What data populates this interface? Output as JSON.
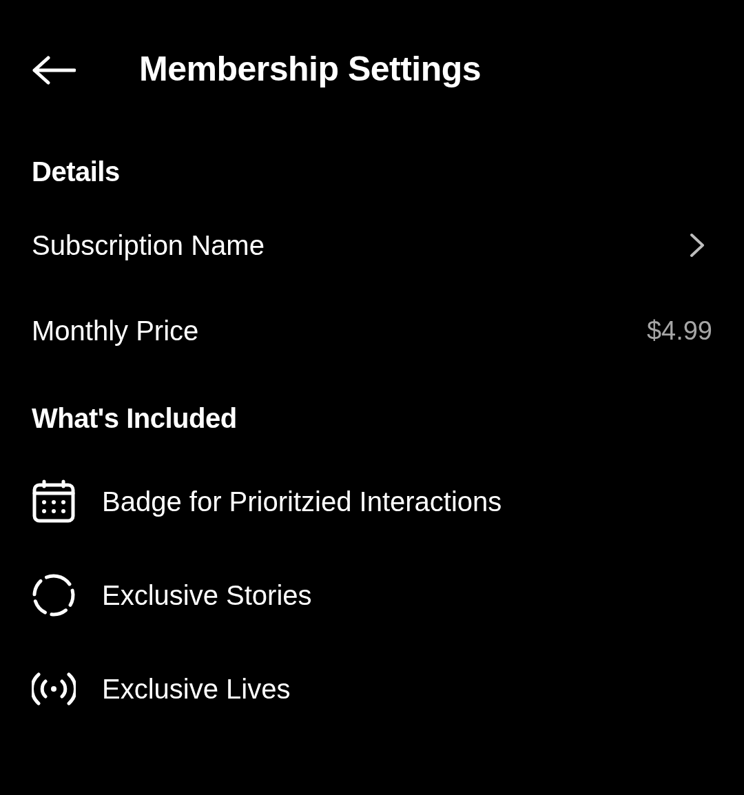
{
  "header": {
    "title": "Membership Settings"
  },
  "sections": [
    {
      "heading": "Details",
      "rows": [
        {
          "kind": "link",
          "label": "Subscription Name"
        },
        {
          "kind": "value",
          "label": "Monthly Price",
          "value": "$4.99"
        }
      ]
    },
    {
      "heading": "What's Included",
      "features": [
        {
          "kind": "calendar",
          "label": "Badge for Prioritzied Interactions"
        },
        {
          "kind": "story",
          "label": "Exclusive Stories"
        },
        {
          "kind": "live",
          "label": "Exclusive Lives"
        }
      ]
    }
  ]
}
